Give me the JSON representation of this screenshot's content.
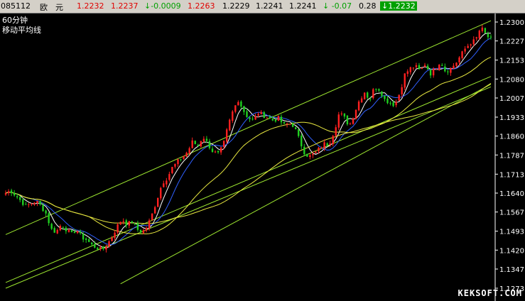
{
  "quote": {
    "code": "085112",
    "name": "欧　元",
    "v1": "1.2232",
    "v2": "1.2237",
    "change": "↓-0.0009",
    "v3": "1.2263",
    "v4": "1.2229",
    "v5": "1.2241",
    "v6": "1.2241",
    "change_pct": "↓ -0.07",
    "v7": "0.28",
    "last": "↓1.2232"
  },
  "panel": {
    "period": "60分钟",
    "indicator": "移动平均线"
  },
  "watermark": "KEKSOFT.COM",
  "colors": {
    "background": "#000000",
    "up": "#ff2020",
    "down": "#20d020",
    "ma_white": "#ffffff",
    "ma_blue": "#3060ff",
    "ma_yellow": "#e8e840",
    "trend": "#9ee830",
    "axis": "#ffffff"
  },
  "chart_data": {
    "type": "candlestick",
    "y_ticks": [
      "1.2300",
      "1.2227",
      "1.2153",
      "1.2080",
      "1.2007",
      "1.1933",
      "1.1860",
      "1.1787",
      "1.1713",
      "1.1640",
      "1.1567",
      "1.1493",
      "1.1420",
      "1.1347",
      "1.1273"
    ],
    "ylim": [
      1.1273,
      1.23
    ],
    "close": [
      1.164,
      1.165,
      1.163,
      1.161,
      1.159,
      1.16,
      1.161,
      1.159,
      1.156,
      1.15,
      1.149,
      1.152,
      1.15,
      1.148,
      1.15,
      1.147,
      1.146,
      1.144,
      1.143,
      1.142,
      1.144,
      1.147,
      1.151,
      1.154,
      1.152,
      1.153,
      1.15,
      1.149,
      1.151,
      1.156,
      1.162,
      1.168,
      1.17,
      1.174,
      1.176,
      1.178,
      1.18,
      1.184,
      1.182,
      1.186,
      1.183,
      1.18,
      1.179,
      1.182,
      1.19,
      1.196,
      1.2,
      1.196,
      1.193,
      1.192,
      1.195,
      1.194,
      1.193,
      1.192,
      1.193,
      1.19,
      1.191,
      1.19,
      1.185,
      1.18,
      1.178,
      1.179,
      1.181,
      1.183,
      1.183,
      1.188,
      1.195,
      1.193,
      1.19,
      1.195,
      1.2,
      1.203,
      1.2,
      1.205,
      1.204,
      1.2,
      1.199,
      1.198,
      1.203,
      1.21,
      1.212,
      1.213,
      1.211,
      1.214,
      1.21,
      1.212,
      1.215,
      1.211,
      1.212,
      1.214,
      1.217,
      1.22,
      1.222,
      1.223,
      1.228,
      1.225,
      1.2232
    ]
  }
}
